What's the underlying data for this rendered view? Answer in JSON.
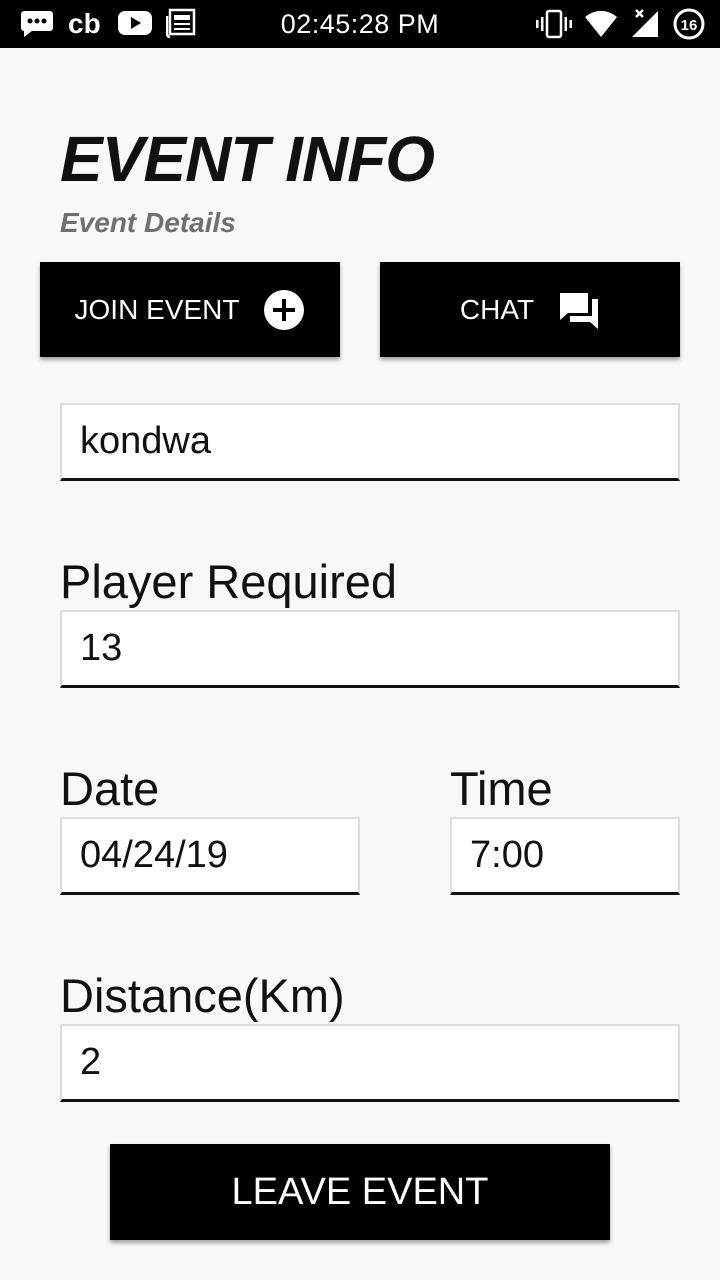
{
  "status_bar": {
    "time": "02:45:28 PM",
    "left_icons": [
      "message-icon",
      "cb-icon",
      "youtube-icon",
      "news-icon"
    ],
    "right_icons": [
      "vibrate-icon",
      "wifi-icon",
      "signal-icon",
      "battery-icon"
    ],
    "battery_level": "16"
  },
  "header": {
    "title": "EVENT INFO",
    "subtitle": "Event Details"
  },
  "actions": {
    "join_label": "JOIN EVENT",
    "join_icon": "add-circle-icon",
    "chat_label": "CHAT",
    "chat_icon": "chat-icon"
  },
  "form": {
    "location_value": "kondwa",
    "players_label": "Player Required",
    "players_value": "13",
    "date_label": "Date",
    "date_value": "04/24/19",
    "time_label": "Time",
    "time_value": "7:00",
    "distance_label": "Distance(Km)",
    "distance_value": "2"
  },
  "footer": {
    "leave_label": "LEAVE EVENT"
  }
}
